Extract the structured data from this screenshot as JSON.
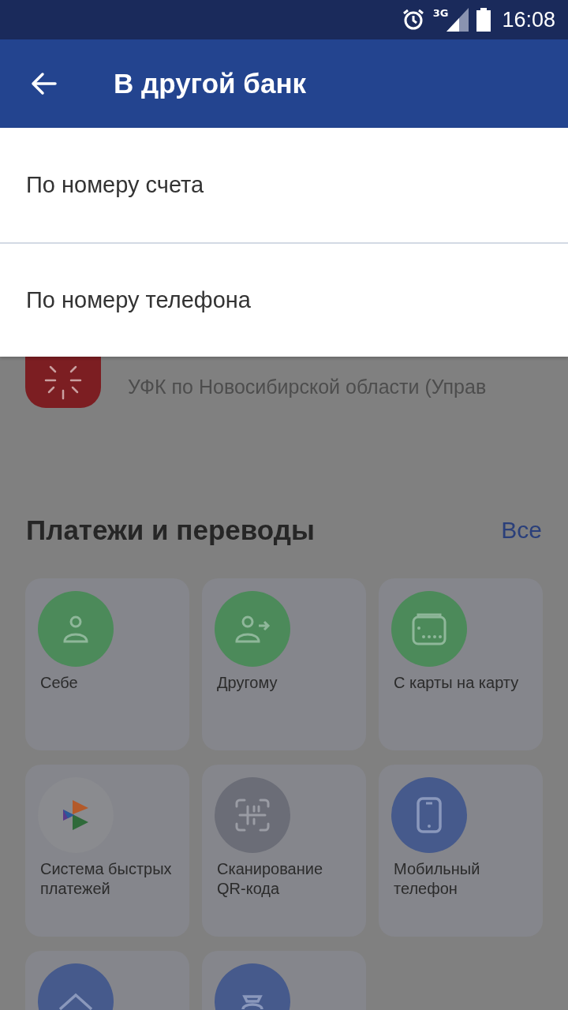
{
  "status_bar": {
    "network": "3G",
    "time": "16:08"
  },
  "app_bar": {
    "title": "В другой банк"
  },
  "options": [
    {
      "label": "По номеру счета"
    },
    {
      "label": "По номеру телефона"
    }
  ],
  "background": {
    "payment": {
      "subtitle": "УФК по Новосибирской области (Управ"
    },
    "section": {
      "title": "Платежи и переводы",
      "link": "Все"
    },
    "tiles": [
      {
        "kind": "person",
        "label": "Себе",
        "color": "#4c8a5a"
      },
      {
        "kind": "person-arrow",
        "label": "Другому",
        "color": "#4c8a5a"
      },
      {
        "kind": "card",
        "label": "С карты на карту",
        "color": "#4c8a5a"
      },
      {
        "kind": "sbp",
        "label": "Система быстрых платежей",
        "color": "#8a8b8f"
      },
      {
        "kind": "qr",
        "label": "Сканирование QR-кода",
        "color": "#6b6d77"
      },
      {
        "kind": "phone",
        "label": "Мобильный телефон",
        "color": "#465a8c"
      },
      {
        "kind": "house",
        "color": "#465a8c"
      },
      {
        "kind": "bag",
        "color": "#465a8c"
      }
    ]
  }
}
